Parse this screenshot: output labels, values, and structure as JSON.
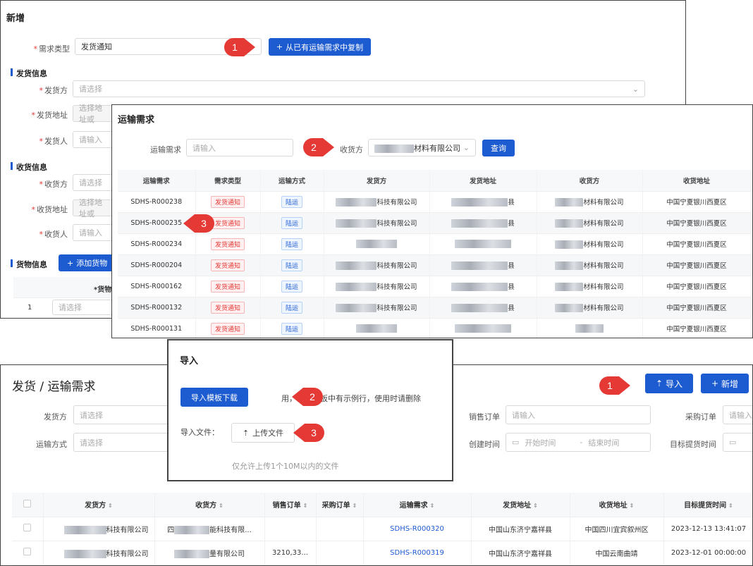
{
  "top_form": {
    "title": "新增",
    "demand_type": {
      "label": "需求类型",
      "value": "发货通知"
    },
    "copy_button": "从已有运输需求中复制",
    "shipper_section": "发货信息",
    "shipper": {
      "label": "发货方",
      "placeholder": "请选择"
    },
    "ship_address": {
      "label": "发货地址",
      "placeholder": "选择地址或"
    },
    "shipper_person": {
      "label": "发货人",
      "placeholder": "请输入"
    },
    "receiver_section": "收货信息",
    "receiver": {
      "label": "收货方",
      "placeholder": "请选择"
    },
    "receive_address": {
      "label": "收货地址",
      "placeholder": "选择地址或"
    },
    "receiver_person": {
      "label": "收货人",
      "placeholder": "请输入"
    },
    "goods_section": "货物信息",
    "add_goods_button": "添加货物",
    "goods_header": "*货物",
    "goods_row_index": "1",
    "goods_row_placeholder": "请选择"
  },
  "transport_dialog": {
    "title": "运输需求",
    "search_label": "运输需求",
    "search_placeholder": "请输入",
    "receiver_label": "收货方",
    "receiver_value": "材料有限公司",
    "query_button": "查询",
    "columns": [
      "运输需求",
      "需求类型",
      "运输方式",
      "发货方",
      "发货地址",
      "收货方",
      "收货地址"
    ],
    "rows": [
      {
        "id": "SDHS-R000238",
        "type": "发货通知",
        "mode": "陆运",
        "shipper": "科技有限公司",
        "address": "县",
        "receiver": "材料有限公司",
        "recv_addr": "中国宁夏银川西夏区"
      },
      {
        "id": "SDHS-R000235",
        "type": "发货通知",
        "mode": "陆运",
        "shipper": "科技有限公司",
        "address": "县",
        "receiver": "材料有限公司",
        "recv_addr": "中国宁夏银川西夏区"
      },
      {
        "id": "SDHS-R000234",
        "type": "发货通知",
        "mode": "陆运",
        "shipper": "",
        "address": "",
        "receiver": "材料有限公司",
        "recv_addr": "中国宁夏银川西夏区"
      },
      {
        "id": "SDHS-R000204",
        "type": "发货通知",
        "mode": "陆运",
        "shipper": "科技有限公司",
        "address": "县",
        "receiver": "材料有限公司",
        "recv_addr": "中国宁夏银川西夏区"
      },
      {
        "id": "SDHS-R000162",
        "type": "发货通知",
        "mode": "陆运",
        "shipper": "科技有限公司",
        "address": "县",
        "receiver": "材料有限公司",
        "recv_addr": "中国宁夏银川西夏区"
      },
      {
        "id": "SDHS-R000132",
        "type": "发货通知",
        "mode": "陆运",
        "shipper": "科技有限公司",
        "address": "县",
        "receiver": "材料有限公司",
        "recv_addr": "中国宁夏银川西夏区"
      },
      {
        "id": "SDHS-R000131",
        "type": "发货通知",
        "mode": "陆运",
        "shipper": "",
        "address": "",
        "receiver": "",
        "recv_addr": "中国宁夏银川西夏区"
      }
    ]
  },
  "import_dialog": {
    "title": "导入",
    "download_button": "导入模板下载",
    "hint": "用，导入模板中有示例行，使用时请删除",
    "file_label": "导入文件：",
    "upload_button": "上传文件",
    "upload_tip": "仅允许上传1个10M以内的文件"
  },
  "list_page": {
    "title": "发货 / 运输需求",
    "import_button": "导入",
    "new_button": "新增",
    "filters": {
      "shipper": {
        "label": "发货方",
        "placeholder": "请选择"
      },
      "transport_mode": {
        "label": "运输方式",
        "placeholder": "请选择"
      },
      "sales_order": {
        "label": "销售订单",
        "placeholder": "请输入"
      },
      "purchase_order": {
        "label": "采购订单",
        "placeholder": "请输入"
      },
      "create_time": {
        "label": "创建时间",
        "start": "开始时间",
        "end": "结束时间",
        "sep": "-"
      },
      "target_time": {
        "label": "目标提货时间"
      }
    },
    "columns": [
      "发货方",
      "收货方",
      "销售订单",
      "采购订单",
      "运输需求",
      "发货地址",
      "收货地址",
      "目标提货时间"
    ],
    "rows": [
      {
        "shipper": "科技有限公司",
        "receiver_prefix": "四",
        "receiver": "能科技有限...",
        "sales": "",
        "purchase": "",
        "id": "SDHS-R000320",
        "ship_addr": "中国山东济宁嘉祥县",
        "recv_addr": "中国四川宜宾叙州区",
        "time": "2023-12-13 13:41:07"
      },
      {
        "shipper": "科技有限公司",
        "receiver_prefix": "",
        "receiver": "量有限公司",
        "sales": "3210,33...",
        "purchase": "",
        "id": "SDHS-R000319",
        "ship_addr": "中国山东济宁嘉祥县",
        "recv_addr": "中国云南曲靖",
        "time": "2023-12-01 00:00:00"
      }
    ]
  },
  "markers": {
    "top": [
      "1",
      "2",
      "3"
    ],
    "bottom": [
      "1",
      "2",
      "3"
    ]
  },
  "colors": {
    "primary": "#1d5bd1",
    "marker": "#e53935"
  }
}
